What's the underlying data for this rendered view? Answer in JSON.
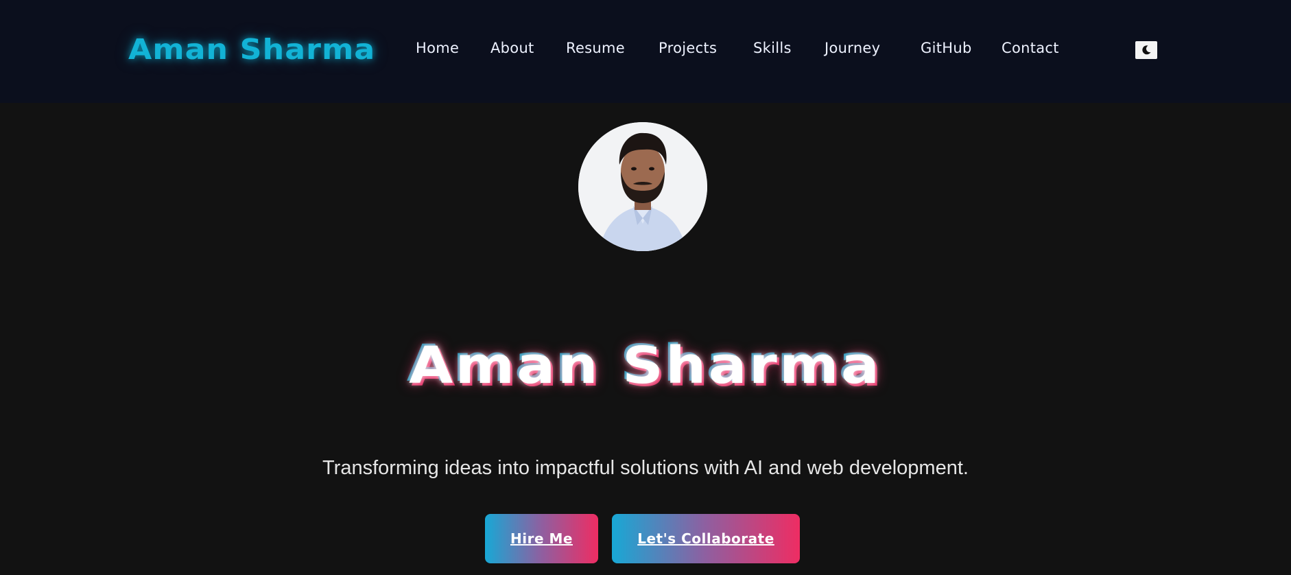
{
  "header": {
    "brand": "Aman Sharma",
    "nav": [
      {
        "label": "Home"
      },
      {
        "label": "About"
      },
      {
        "label": "Resume"
      },
      {
        "label": "Projects"
      },
      {
        "label": "Skills"
      },
      {
        "label": "Journey"
      },
      {
        "label": "GitHub"
      },
      {
        "label": "Contact"
      }
    ],
    "theme_toggle_icon": "moon-icon"
  },
  "hero": {
    "avatar_icon": "profile-photo",
    "title": "Aman Sharma",
    "tagline": "Transforming ideas into impactful solutions with AI and web development.",
    "buttons": {
      "hire": "Hire Me",
      "collaborate": "Let's Collaborate"
    }
  },
  "colors": {
    "accent_cyan": "#12b3d6",
    "accent_pink": "#ee2d63",
    "nav_bg": "#0b0f1d",
    "page_bg": "#121212"
  }
}
